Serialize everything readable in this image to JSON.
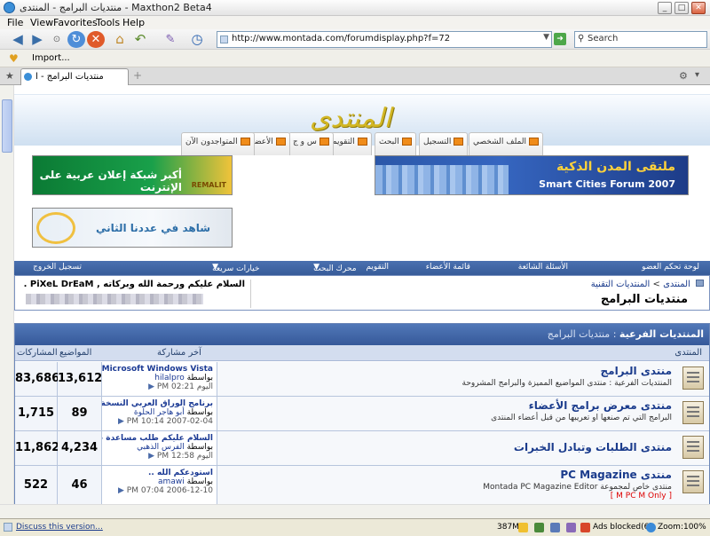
{
  "window": {
    "title": "منتديات البرامج - المنتدى - Maxthon2 Beta4",
    "min": "_",
    "max": "□",
    "close": "✕"
  },
  "menu": [
    "File",
    "View",
    "Favorites",
    "Tools",
    "Help"
  ],
  "address": {
    "url": "http://www.montada.com/forumdisplay.php?f=72"
  },
  "search": {
    "placeholder": "Search"
  },
  "favbar": {
    "import_label": "Import..."
  },
  "tab": {
    "label": "منتديات البرامج - ا"
  },
  "site": {
    "logo": "المنتدى",
    "nav_tabs": [
      "الملف الشخصي",
      "التسجيل",
      "البحث",
      "التقويم",
      "س و ج",
      "الأعضاء",
      "المتواجدون الآن"
    ],
    "ad_left_1": "أكبر شبكة إعلان عربية على الإنترنت",
    "ad_left_1_brand": "REMALIT",
    "ad_right_1_ar": "ملتقى المدن الذكية",
    "ad_right_1_en": "Smart Cities Forum 2007",
    "ad_left_2": "شاهد في عددنا الثاني"
  },
  "navbar": {
    "items": [
      "لوحة تحكم العضو",
      "الأسئلة الشائعة",
      "قائمة الأعضاء",
      "التقويم",
      "محرك البحث",
      "خيارات سريعة",
      "تسجيل الخروج"
    ]
  },
  "welcome": {
    "message": "السلام عليكم ورحمة الله وبركاته , PiXeL DrEaM ."
  },
  "breadcrumb": {
    "root": "المنتدى",
    "sep": ">",
    "section": "المنتديات التقنية",
    "title": "منتديات البرامج"
  },
  "forum": {
    "header_label": "المنتديات الفرعية",
    "header_sub": ": منتديات البرامج",
    "columns": {
      "forum": "المنتدى",
      "last_post": "آخر مشاركة",
      "threads": "المواضيع",
      "posts": "المشاركات"
    },
    "rows": [
      {
        "name": "منتدى البرامج",
        "desc": "المنتديات الفرعية : منتدى المواضيع المميزة والبرامج المشروحة",
        "red": "",
        "last_title": "Microsoft Windows Vista...",
        "by_prefix": "بواسطة",
        "by": "hilalpro",
        "date": "اليوم",
        "time": "02:21 PM",
        "threads": "13,612",
        "posts": "83,686"
      },
      {
        "name": "منتدى معرض برامج الأعضاء",
        "desc": "البرامج التي تم صنعها او تعريبها من قبل أعضاء المنتدى",
        "red": "",
        "last_title": "برنامج الوراق العربي النسخة...",
        "by_prefix": "بواسطة",
        "by": "أبو هاجر الحلوة",
        "date": "2007-02-04",
        "time": "10:14 PM",
        "threads": "89",
        "posts": "1,715"
      },
      {
        "name": "منتدى الطلبات وتبادل الخبرات",
        "desc": "",
        "red": "",
        "last_title": "السلام عليكم طلب مساعدة ب...",
        "by_prefix": "بواسطة",
        "by": "الفرس الذهبي",
        "date": "اليوم",
        "time": "12:58 PM",
        "threads": "4,234",
        "posts": "11,862"
      },
      {
        "name": "منتدى PC Magazine",
        "desc": "منتدى خاص لمجموعة Montada PC Magazine Editor",
        "red": "[ M PC M Only ]",
        "last_title": "أستودعكم الله ..",
        "by_prefix": "بواسطة",
        "by": "amawi",
        "date": "2006-12-10",
        "time": "07:04 PM",
        "threads": "46",
        "posts": "522"
      }
    ]
  },
  "status": {
    "left_link": "Discuss this version...",
    "memory": "387M",
    "ads": "Ads blocked(6)",
    "zoom": "Zoom:100%"
  }
}
